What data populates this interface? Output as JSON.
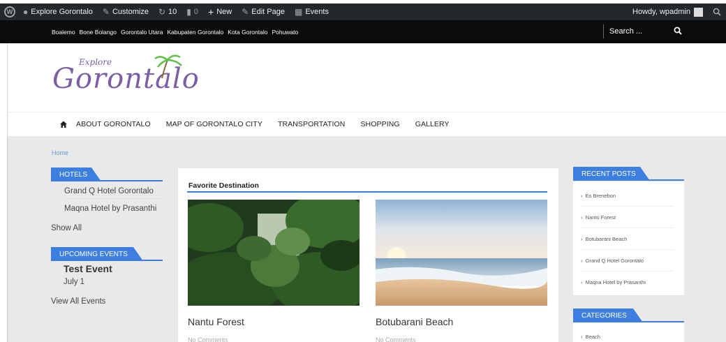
{
  "adminbar": {
    "site_name": "Explore Gorontalo",
    "customize": "Customize",
    "updates_count": "10",
    "comments_count": "0",
    "new_label": "New",
    "edit_page": "Edit Page",
    "events": "Events",
    "howdy": "Howdy, wpadmin"
  },
  "topnav": {
    "links": [
      "Boalemo",
      "Bone Bolango",
      "Gorontalo Utara",
      "Kabupaten Gorontalo",
      "Kota Gorontalo",
      "Pohuwato"
    ],
    "search_placeholder": "Search ..."
  },
  "logo": {
    "small": "Explore",
    "main": "Gorontalo"
  },
  "mainmenu": {
    "items": [
      "ABOUT GORONTALO",
      "MAP OF GORONTALO CITY",
      "TRANSPORTATION",
      "SHOPPING",
      "GALLERY"
    ]
  },
  "breadcrumb": "Home",
  "left_sidebar": {
    "hotels_title": "HOTELS",
    "hotels": [
      "Grand Q Hotel Gorontalo",
      "Maqna Hotel by Prasanthi"
    ],
    "hotels_show_all": "Show All",
    "events_title": "UPCOMING EVENTS",
    "event_title": "Test Event",
    "event_date": "July 1",
    "events_view_all": "View All Events"
  },
  "main": {
    "section_title": "Favorite Destination",
    "cards": [
      {
        "title": "Nantu Forest",
        "meta": "No Comments"
      },
      {
        "title": "Botubarani Beach",
        "meta": "No Comments"
      }
    ]
  },
  "right_sidebar": {
    "recent_title": "RECENT POSTS",
    "recent_posts": [
      "Es Brenebon",
      "Nantu Forest",
      "Botubarani Beach",
      "Grand Q Hotel Gorontalo",
      "Maqna Hotel by Prasanthi"
    ],
    "categories_title": "CATEGORIES",
    "categories": [
      "Beach"
    ]
  },
  "colors": {
    "accent": "#3d7fe0",
    "adminbar": "#23282d",
    "logo": "#7c5ea6"
  }
}
